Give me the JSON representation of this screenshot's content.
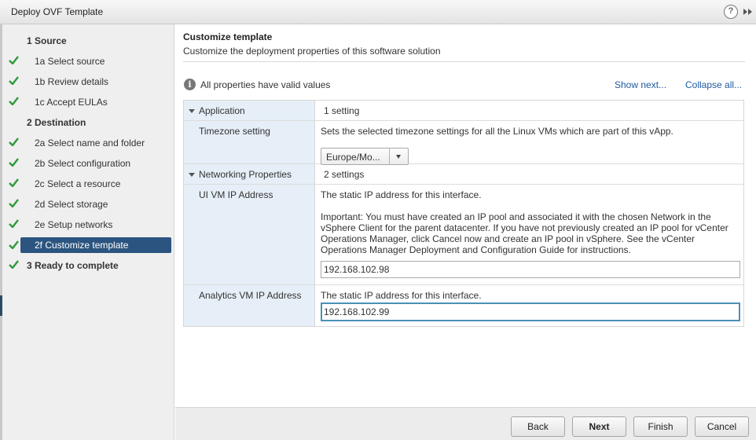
{
  "window": {
    "title": "Deploy OVF Template",
    "help_label": "?"
  },
  "sidebar": {
    "steps": [
      {
        "label": "1  Source",
        "kind": "head",
        "checked": false
      },
      {
        "label": "1a  Select source",
        "kind": "sub",
        "checked": true
      },
      {
        "label": "1b  Review details",
        "kind": "sub",
        "checked": true
      },
      {
        "label": "1c  Accept EULAs",
        "kind": "sub",
        "checked": true
      },
      {
        "label": "2  Destination",
        "kind": "head",
        "checked": false
      },
      {
        "label": "2a  Select name and folder",
        "kind": "sub",
        "checked": true
      },
      {
        "label": "2b  Select configuration",
        "kind": "sub",
        "checked": true
      },
      {
        "label": "2c  Select a resource",
        "kind": "sub",
        "checked": true
      },
      {
        "label": "2d  Select storage",
        "kind": "sub",
        "checked": true
      },
      {
        "label": "2e  Setup networks",
        "kind": "sub",
        "checked": true
      },
      {
        "label": "2f  Customize template",
        "kind": "sub",
        "checked": true,
        "active": true
      },
      {
        "label": "3  Ready to complete",
        "kind": "head",
        "checked": true
      }
    ]
  },
  "main": {
    "title": "Customize template",
    "subtitle": "Customize the deployment properties of this software solution",
    "status_icon": "info-icon",
    "status_text": "All properties have valid values",
    "show_next_label": "Show next...",
    "collapse_all_label": "Collapse all..."
  },
  "properties": {
    "application": {
      "group_label": "Application",
      "count": "1 setting",
      "timezone": {
        "label": "Timezone setting",
        "description": "Sets the selected timezone settings for all the Linux VMs which are part of this vApp.",
        "selected": "Europe/Mo..."
      }
    },
    "networking": {
      "group_label": "Networking Properties",
      "count": "2 settings",
      "ui_vm": {
        "label": "UI VM IP Address",
        "description": "The static IP address for this interface.",
        "important": "Important: You must have created an IP pool and associated it with the chosen Network in the vSphere Client for the parent datacenter. If you have not previously created an IP pool for vCenter Operations Manager, click Cancel now and create an IP pool in vSphere. See the vCenter Operations Manager Deployment and Configuration Guide for instructions.",
        "value": "192.168.102.98"
      },
      "analytics_vm": {
        "label": "Analytics VM IP Address",
        "description": "The static IP address for this interface.",
        "value": "192.168.102.99"
      }
    }
  },
  "footer": {
    "back_label": "Back",
    "next_label": "Next",
    "finish_label": "Finish",
    "cancel_label": "Cancel"
  },
  "colors": {
    "active_step": "#2b5580",
    "check": "#2e9a3a",
    "link": "#1e5aa0",
    "focus_border": "#4a90b8"
  }
}
